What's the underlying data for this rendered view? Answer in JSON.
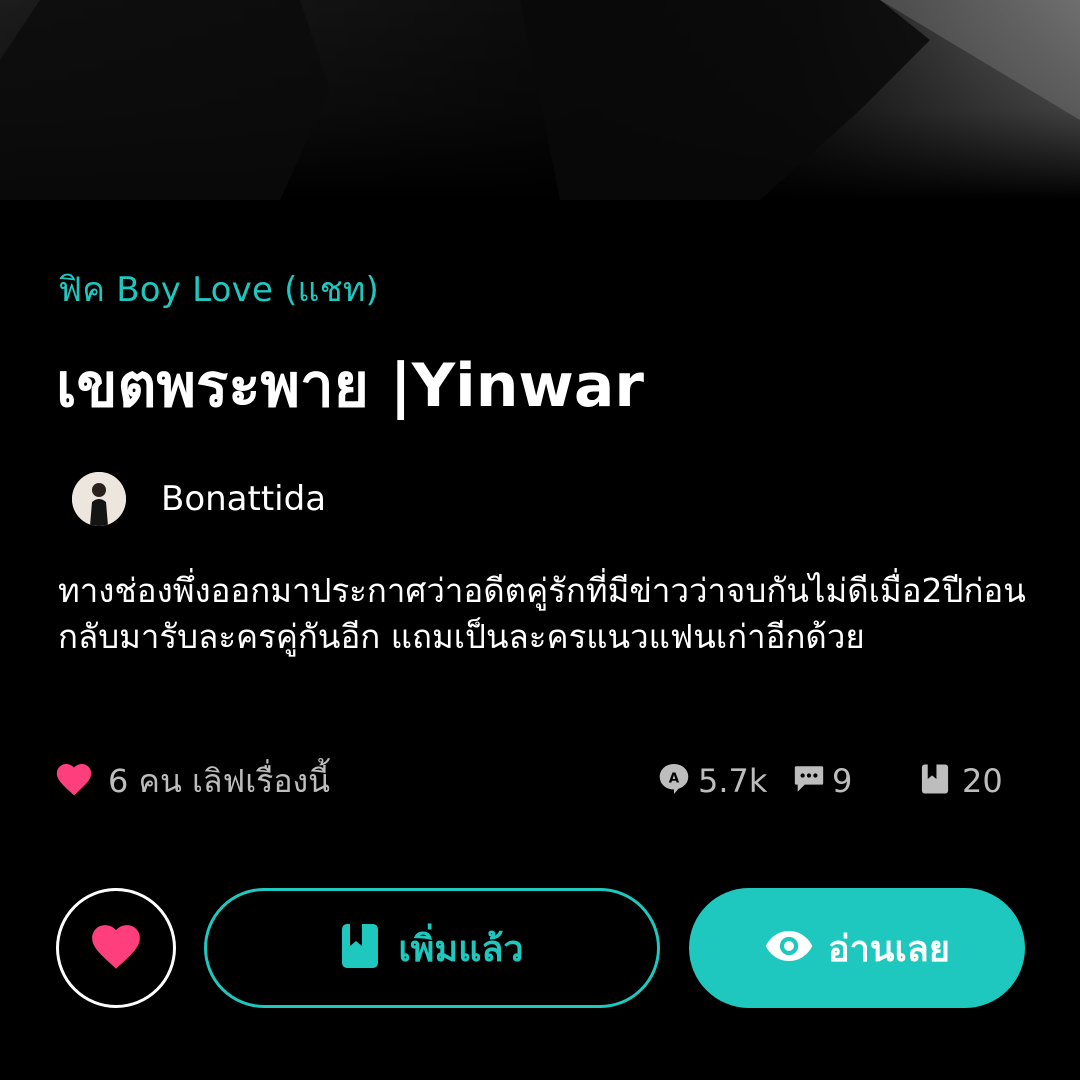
{
  "story": {
    "genre": "ฟิค Boy Love (แชท)",
    "title": "เขตพระพาย |Yinwar",
    "author": "Bonattida",
    "synopsis": "ทางช่องพึ่งออกมาประกาศว่าอดีตคู่รักที่มีข่าวว่าจบกันไม่ดีเมื่อ2ปีก่อนกลับมารับละครคู่กันอีก แถมเป็นละครแนวแฟนเก่าอีกด้วย"
  },
  "stats": {
    "love_text": "6 คน เลิฟเรื่องนี้",
    "views": "5.7k",
    "comments": "9",
    "chapters": "20"
  },
  "actions": {
    "added_label": "เพิ่มแล้ว",
    "read_label": "อ่านเลย"
  },
  "colors": {
    "accent": "#1fc8bf",
    "heart": "#ff3f7d",
    "background": "#000000",
    "muted_text": "#bdbdbd"
  },
  "icons": {
    "love": "heart-icon",
    "views": "views-icon",
    "comments": "comment-icon",
    "chapters": "book-icon",
    "favorite": "heart-icon",
    "added": "bookmark-book-icon",
    "read": "eye-icon"
  }
}
